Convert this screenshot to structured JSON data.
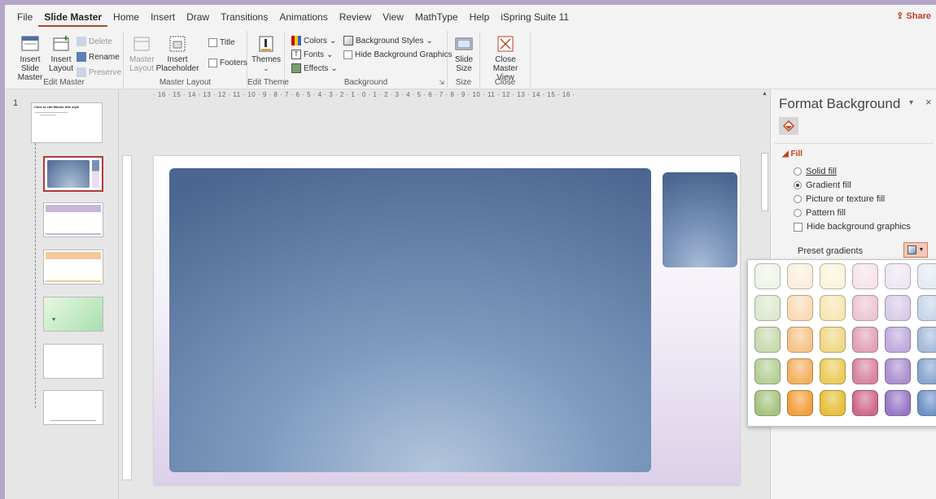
{
  "ribbon": {
    "tabs": [
      "File",
      "Slide Master",
      "Home",
      "Insert",
      "Draw",
      "Transitions",
      "Animations",
      "Review",
      "View",
      "MathType",
      "Help",
      "iSpring Suite 11"
    ],
    "active_tab": "Slide Master",
    "share_label": "Share",
    "groups": {
      "edit_master": {
        "label": "Edit Master",
        "insert_slide_master": "Insert Slide Master",
        "insert_layout": "Insert Layout",
        "delete": "Delete",
        "rename": "Rename",
        "preserve": "Preserve"
      },
      "master_layout": {
        "label": "Master Layout",
        "master_layout_btn": "Master Layout",
        "insert_placeholder": "Insert Placeholder",
        "title": "Title",
        "footers": "Footers"
      },
      "edit_theme": {
        "label": "Edit Theme",
        "themes": "Themes"
      },
      "background": {
        "label": "Background",
        "colors": "Colors",
        "fonts": "Fonts",
        "effects": "Effects",
        "background_styles": "Background Styles",
        "hide_background_graphics": "Hide Background Graphics"
      },
      "size": {
        "label": "Size",
        "slide_size": "Slide Size"
      },
      "close": {
        "label": "Close",
        "close_master_view": "Close Master View"
      }
    }
  },
  "thumbnails": {
    "slide_number": "1",
    "master_title": "Click to edit Master title style"
  },
  "ruler": {
    "horizontal": "· 16 · 15 · 14 · 13 · 12 · 11 · 10 · 9 · 8 · 7 · 6 · 5 · 4 · 3 · 2 · 1 · 0 · 1 · 2 · 3 · 4 · 5 · 6 · 7 · 8 · 9 · 10 · 11 · 12 · 13 · 14 · 15 · 16 ·"
  },
  "format_pane": {
    "title": "Format Background",
    "fill_header": "Fill",
    "options": [
      {
        "label": "Solid fill",
        "selected": false,
        "type": "radio"
      },
      {
        "label": "Gradient fill",
        "selected": true,
        "type": "radio"
      },
      {
        "label": "Picture or texture fill",
        "selected": false,
        "type": "radio"
      },
      {
        "label": "Pattern fill",
        "selected": false,
        "type": "radio"
      },
      {
        "label": "Hide background graphics",
        "selected": false,
        "type": "checkbox"
      }
    ],
    "preset_gradients_label": "Preset gradients"
  },
  "colors": {
    "accent": "#c43e1c",
    "gallery_columns": [
      "#a6c47f",
      "#f0a040",
      "#e6c03a",
      "#d06a8a",
      "#9a78c6",
      "#6f92c4"
    ]
  }
}
